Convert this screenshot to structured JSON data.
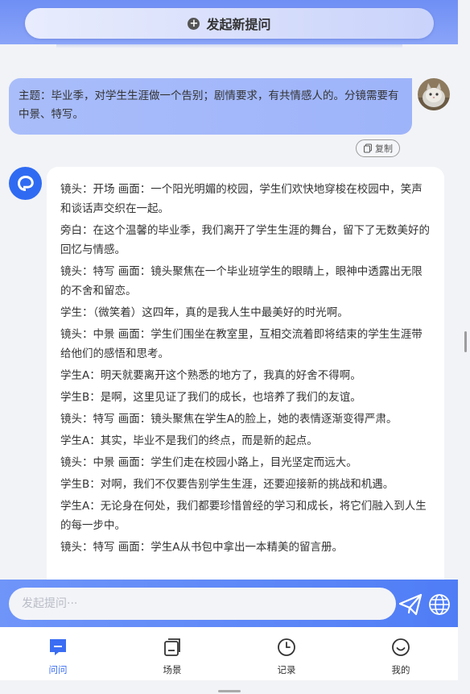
{
  "header": {
    "new_question_label": "发起新提问"
  },
  "user_message": {
    "text": "主题：毕业季，对学生生涯做一个告别；剧情要求，有共情感人的。分镜需要有中景、特写。"
  },
  "copy_label": "复制",
  "bot_message": {
    "lines": [
      "镜头：开场 画面：一个阳光明媚的校园，学生们欢快地穿梭在校园中，笑声和谈话声交织在一起。",
      "旁白：在这个温馨的毕业季，我们离开了学生生涯的舞台，留下了无数美好的回忆与情感。",
      "镜头：特写 画面：镜头聚焦在一个毕业班学生的眼睛上，眼神中透露出无限的不舍和留恋。",
      "学生：（微笑着）这四年，真的是我人生中最美好的时光啊。",
      "镜头：中景 画面：学生们围坐在教室里，互相交流着即将结束的学生生涯带给他们的感悟和思考。",
      "学生A：明天就要离开这个熟悉的地方了，我真的好舍不得啊。",
      "学生B：是啊，这里见证了我们的成长，也培养了我们的友谊。",
      "镜头：特写 画面：镜头聚焦在学生A的脸上，她的表情逐渐变得严肃。",
      "学生A：其实，毕业不是我们的终点，而是新的起点。",
      "镜头：中景 画面：学生们走在校园小路上，目光坚定而远大。",
      "学生B：对啊，我们不仅要告别学生生涯，还要迎接新的挑战和机遇。",
      "学生A：无论身在何处，我们都要珍惜曾经的学习和成长，将它们融入到人生的每一步中。",
      "镜头：特写 画面：学生A从书包中拿出一本精美的留言册。"
    ]
  },
  "input": {
    "placeholder": "发起提问···"
  },
  "tabs": [
    {
      "label": "问问",
      "icon": "chat-icon",
      "active": true
    },
    {
      "label": "场景",
      "icon": "scene-icon",
      "active": false
    },
    {
      "label": "记录",
      "icon": "clock-icon",
      "active": false
    },
    {
      "label": "我的",
      "icon": "smile-icon",
      "active": false
    }
  ],
  "colors": {
    "accent": "#3a6df3",
    "header": "#7b97f6",
    "user_bubble": "#a4b9fa"
  }
}
